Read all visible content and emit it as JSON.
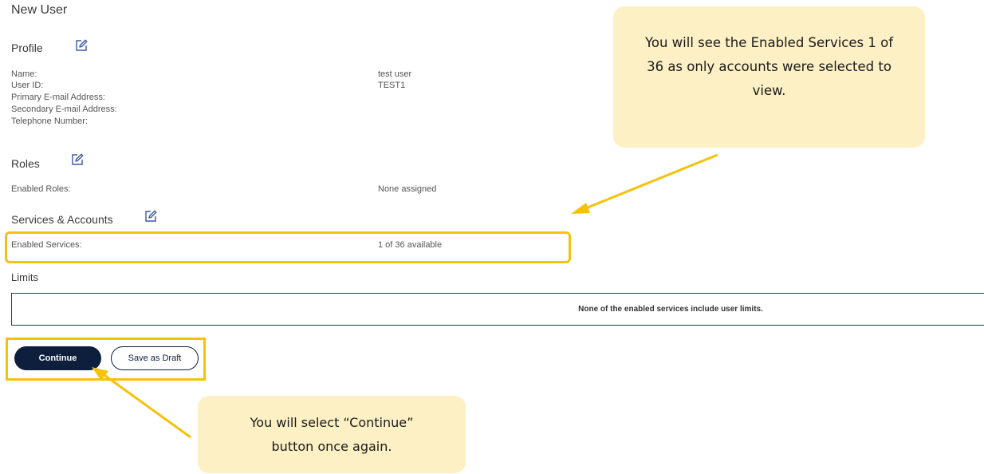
{
  "page_title": "New User",
  "profile": {
    "title": "Profile",
    "fields": [
      {
        "label": "Name:",
        "value": "test user"
      },
      {
        "label": "User ID:",
        "value": "TEST1"
      },
      {
        "label": "Primary E-mail Address:",
        "value": ""
      },
      {
        "label": "Secondary E-mail Address:",
        "value": ""
      },
      {
        "label": "Telephone Number:",
        "value": ""
      }
    ]
  },
  "roles": {
    "title": "Roles",
    "enabled_label": "Enabled Roles:",
    "enabled_value": "None assigned"
  },
  "services": {
    "title": "Services & Accounts",
    "enabled_label": "Enabled Services:",
    "enabled_value": "1 of 36 available"
  },
  "limits": {
    "title": "Limits",
    "message": "None of the enabled services include user limits."
  },
  "actions": {
    "continue_label": "Continue",
    "draft_label": "Save as Draft"
  },
  "callouts": {
    "services_note": "You will see the Enabled Services 1 of 36 as only accounts were selected to view.",
    "continue_note": "You will select “Continue” button once again."
  },
  "colors": {
    "accent_highlight": "#f4c20d",
    "callout_bg": "#fdf0c4",
    "primary_button": "#0d1f3c"
  }
}
